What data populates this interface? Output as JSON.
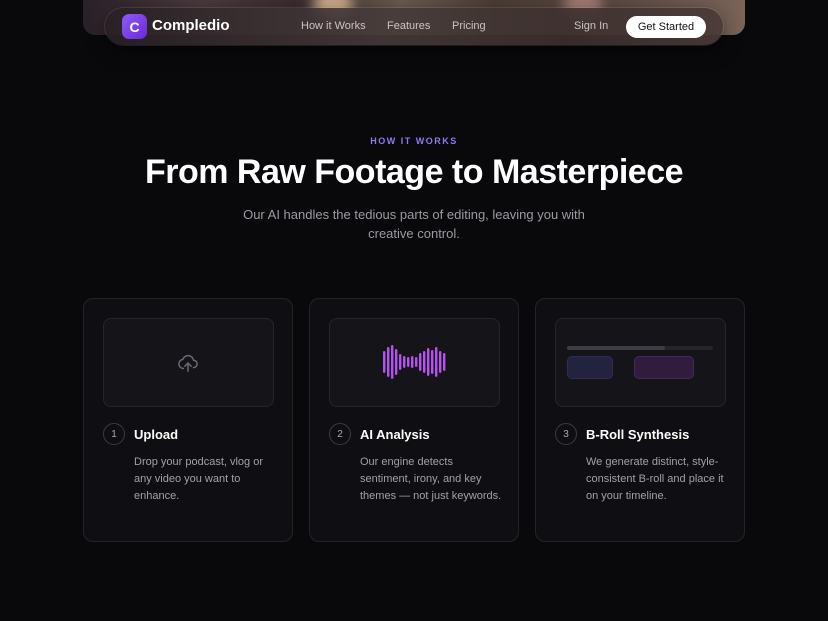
{
  "nav": {
    "brand_initial": "C",
    "brand_name": "Compledio",
    "links": [
      "How it Works",
      "Features",
      "Pricing"
    ],
    "sign_in": "Sign In",
    "cta": "Get Started"
  },
  "section": {
    "eyebrow": "HOW IT WORKS",
    "title": "From Raw Footage to Masterpiece",
    "subtitle": "Our AI handles the tedious parts of editing, leaving you with creative control."
  },
  "steps": [
    {
      "number": "1",
      "title": "Upload",
      "description": "Drop your podcast, vlog or any video you want to enhance.",
      "icon": "cloud-upload-icon"
    },
    {
      "number": "2",
      "title": "AI Analysis",
      "description": "Our engine detects sentiment, irony, and key themes — not just keywords.",
      "icon": "waveform-icon"
    },
    {
      "number": "3",
      "title": "B-Roll Synthesis",
      "description": "We generate distinct, style-consistent B-roll and place it on your timeline.",
      "icon": "timeline-icon"
    }
  ],
  "colors": {
    "accent": "#8b5cf6",
    "eyebrow": "#8b7cf0",
    "waveform": "#b04ef0",
    "background": "#09090c"
  }
}
